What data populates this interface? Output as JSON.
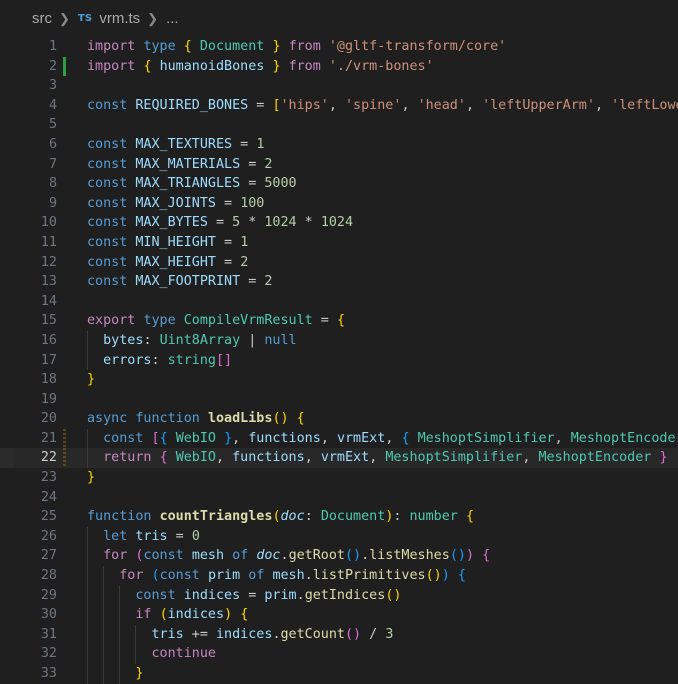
{
  "breadcrumb": {
    "folder": "src",
    "file_icon": "TS",
    "file": "vrm.ts",
    "symbol": "..."
  },
  "editor": {
    "current_line": 22,
    "lines": [
      {
        "n": "1",
        "tokens": [
          [
            "kw2",
            "import"
          ],
          [
            "c",
            " "
          ],
          [
            "kw",
            "type"
          ],
          [
            "c",
            " "
          ],
          [
            "br1",
            "{"
          ],
          [
            "c",
            " "
          ],
          [
            "ty",
            "Document"
          ],
          [
            "c",
            " "
          ],
          [
            "br1",
            "}"
          ],
          [
            "c",
            " "
          ],
          [
            "kw2",
            "from"
          ],
          [
            "c",
            " "
          ],
          [
            "str",
            "'@gltf-transform/core'"
          ]
        ]
      },
      {
        "n": "2",
        "git": "added",
        "tokens": [
          [
            "kw2",
            "import"
          ],
          [
            "c",
            " "
          ],
          [
            "br1",
            "{"
          ],
          [
            "c",
            " "
          ],
          [
            "v",
            "humanoidBones"
          ],
          [
            "c",
            " "
          ],
          [
            "br1",
            "}"
          ],
          [
            "c",
            " "
          ],
          [
            "kw2",
            "from"
          ],
          [
            "c",
            " "
          ],
          [
            "str",
            "'./vrm-bones'"
          ]
        ]
      },
      {
        "n": "3",
        "tokens": []
      },
      {
        "n": "4",
        "tokens": [
          [
            "kw",
            "const"
          ],
          [
            "c",
            " "
          ],
          [
            "v",
            "REQUIRED_BONES"
          ],
          [
            "c",
            " = "
          ],
          [
            "br1",
            "["
          ],
          [
            "str",
            "'hips'"
          ],
          [
            "c",
            ", "
          ],
          [
            "str",
            "'spine'"
          ],
          [
            "c",
            ", "
          ],
          [
            "str",
            "'head'"
          ],
          [
            "c",
            ", "
          ],
          [
            "str",
            "'leftUpperArm'"
          ],
          [
            "c",
            ", "
          ],
          [
            "str",
            "'leftLowerA"
          ]
        ]
      },
      {
        "n": "5",
        "tokens": []
      },
      {
        "n": "6",
        "tokens": [
          [
            "kw",
            "const"
          ],
          [
            "c",
            " "
          ],
          [
            "v",
            "MAX_TEXTURES"
          ],
          [
            "c",
            " = "
          ],
          [
            "num",
            "1"
          ]
        ]
      },
      {
        "n": "7",
        "tokens": [
          [
            "kw",
            "const"
          ],
          [
            "c",
            " "
          ],
          [
            "v",
            "MAX_MATERIALS"
          ],
          [
            "c",
            " = "
          ],
          [
            "num",
            "2"
          ]
        ]
      },
      {
        "n": "8",
        "tokens": [
          [
            "kw",
            "const"
          ],
          [
            "c",
            " "
          ],
          [
            "v",
            "MAX_TRIANGLES"
          ],
          [
            "c",
            " = "
          ],
          [
            "num",
            "5000"
          ]
        ]
      },
      {
        "n": "9",
        "tokens": [
          [
            "kw",
            "const"
          ],
          [
            "c",
            " "
          ],
          [
            "v",
            "MAX_JOINTS"
          ],
          [
            "c",
            " = "
          ],
          [
            "num",
            "100"
          ]
        ]
      },
      {
        "n": "10",
        "tokens": [
          [
            "kw",
            "const"
          ],
          [
            "c",
            " "
          ],
          [
            "v",
            "MAX_BYTES"
          ],
          [
            "c",
            " = "
          ],
          [
            "num",
            "5"
          ],
          [
            "c",
            " * "
          ],
          [
            "num",
            "1024"
          ],
          [
            "c",
            " * "
          ],
          [
            "num",
            "1024"
          ]
        ]
      },
      {
        "n": "11",
        "tokens": [
          [
            "kw",
            "const"
          ],
          [
            "c",
            " "
          ],
          [
            "v",
            "MIN_HEIGHT"
          ],
          [
            "c",
            " = "
          ],
          [
            "num",
            "1"
          ]
        ]
      },
      {
        "n": "12",
        "tokens": [
          [
            "kw",
            "const"
          ],
          [
            "c",
            " "
          ],
          [
            "v",
            "MAX_HEIGHT"
          ],
          [
            "c",
            " = "
          ],
          [
            "num",
            "2"
          ]
        ]
      },
      {
        "n": "13",
        "tokens": [
          [
            "kw",
            "const"
          ],
          [
            "c",
            " "
          ],
          [
            "v",
            "MAX_FOOTPRINT"
          ],
          [
            "c",
            " = "
          ],
          [
            "num",
            "2"
          ]
        ]
      },
      {
        "n": "14",
        "tokens": []
      },
      {
        "n": "15",
        "tokens": [
          [
            "kw2",
            "export"
          ],
          [
            "c",
            " "
          ],
          [
            "kw",
            "type"
          ],
          [
            "c",
            " "
          ],
          [
            "ty",
            "CompileVrmResult"
          ],
          [
            "c",
            " = "
          ],
          [
            "br1",
            "{"
          ]
        ]
      },
      {
        "n": "16",
        "indent": 1,
        "tokens": [
          [
            "c",
            "  "
          ],
          [
            "prop",
            "bytes"
          ],
          [
            "c",
            ": "
          ],
          [
            "ty",
            "Uint8Array"
          ],
          [
            "c",
            " | "
          ],
          [
            "kw",
            "null"
          ]
        ]
      },
      {
        "n": "17",
        "indent": 1,
        "tokens": [
          [
            "c",
            "  "
          ],
          [
            "prop",
            "errors"
          ],
          [
            "c",
            ": "
          ],
          [
            "ty",
            "string"
          ],
          [
            "br2",
            "[]"
          ]
        ]
      },
      {
        "n": "18",
        "tokens": [
          [
            "br1",
            "}"
          ]
        ]
      },
      {
        "n": "19",
        "tokens": []
      },
      {
        "n": "20",
        "tokens": [
          [
            "kw",
            "async"
          ],
          [
            "c",
            " "
          ],
          [
            "kw",
            "function"
          ],
          [
            "c",
            " "
          ],
          [
            "fn",
            "loadLibs"
          ],
          [
            "br1",
            "()"
          ],
          [
            "c",
            " "
          ],
          [
            "br1",
            "{"
          ]
        ]
      },
      {
        "n": "21",
        "git": "modified",
        "indent": 1,
        "tokens": [
          [
            "c",
            "  "
          ],
          [
            "kw",
            "const"
          ],
          [
            "c",
            " "
          ],
          [
            "br2",
            "["
          ],
          [
            "br3",
            "{"
          ],
          [
            "c",
            " "
          ],
          [
            "ty",
            "WebIO"
          ],
          [
            "c",
            " "
          ],
          [
            "br3",
            "}"
          ],
          [
            "c",
            ", "
          ],
          [
            "v",
            "functions"
          ],
          [
            "c",
            ", "
          ],
          [
            "v",
            "vrmExt"
          ],
          [
            "c",
            ", "
          ],
          [
            "br3",
            "{"
          ],
          [
            "c",
            " "
          ],
          [
            "ty",
            "MeshoptSimplifier"
          ],
          [
            "c",
            ", "
          ],
          [
            "ty",
            "MeshoptEncoder"
          ],
          [
            "c",
            " "
          ],
          [
            "br3",
            "}"
          ]
        ]
      },
      {
        "n": "22",
        "git": "modified",
        "indent": 1,
        "tokens": [
          [
            "c",
            "  "
          ],
          [
            "kw2",
            "return"
          ],
          [
            "c",
            " "
          ],
          [
            "br2",
            "{"
          ],
          [
            "c",
            " "
          ],
          [
            "ty",
            "WebIO"
          ],
          [
            "c",
            ", "
          ],
          [
            "v",
            "functions"
          ],
          [
            "c",
            ", "
          ],
          [
            "v",
            "vrmExt"
          ],
          [
            "c",
            ", "
          ],
          [
            "ty",
            "MeshoptSimplifier"
          ],
          [
            "c",
            ", "
          ],
          [
            "ty",
            "MeshoptEncoder"
          ],
          [
            "c",
            " "
          ],
          [
            "br2",
            "}"
          ]
        ]
      },
      {
        "n": "23",
        "tokens": [
          [
            "br1",
            "}"
          ]
        ]
      },
      {
        "n": "24",
        "tokens": []
      },
      {
        "n": "25",
        "tokens": [
          [
            "kw",
            "function"
          ],
          [
            "c",
            " "
          ],
          [
            "fn",
            "countTriangles"
          ],
          [
            "br1",
            "("
          ],
          [
            "it",
            "doc"
          ],
          [
            "c",
            ": "
          ],
          [
            "ty",
            "Document"
          ],
          [
            "br1",
            ")"
          ],
          [
            "c",
            ": "
          ],
          [
            "ty",
            "number"
          ],
          [
            "c",
            " "
          ],
          [
            "br1",
            "{"
          ]
        ]
      },
      {
        "n": "26",
        "indent": 1,
        "tokens": [
          [
            "c",
            "  "
          ],
          [
            "kw",
            "let"
          ],
          [
            "c",
            " "
          ],
          [
            "v",
            "tris"
          ],
          [
            "c",
            " = "
          ],
          [
            "num",
            "0"
          ]
        ]
      },
      {
        "n": "27",
        "indent": 1,
        "tokens": [
          [
            "c",
            "  "
          ],
          [
            "kw2",
            "for"
          ],
          [
            "c",
            " "
          ],
          [
            "br2",
            "("
          ],
          [
            "kw",
            "const"
          ],
          [
            "c",
            " "
          ],
          [
            "v",
            "mesh"
          ],
          [
            "c",
            " "
          ],
          [
            "kw",
            "of"
          ],
          [
            "c",
            " "
          ],
          [
            "it",
            "doc"
          ],
          [
            "c",
            "."
          ],
          [
            "mt",
            "getRoot"
          ],
          [
            "br3",
            "()"
          ],
          [
            "c",
            "."
          ],
          [
            "mt",
            "listMeshes"
          ],
          [
            "br3",
            "()"
          ],
          [
            "br2",
            ")"
          ],
          [
            "c",
            " "
          ],
          [
            "br2",
            "{"
          ]
        ]
      },
      {
        "n": "28",
        "indent": 2,
        "tokens": [
          [
            "c",
            "    "
          ],
          [
            "kw2",
            "for"
          ],
          [
            "c",
            " "
          ],
          [
            "br3",
            "("
          ],
          [
            "kw",
            "const"
          ],
          [
            "c",
            " "
          ],
          [
            "v",
            "prim"
          ],
          [
            "c",
            " "
          ],
          [
            "kw",
            "of"
          ],
          [
            "c",
            " "
          ],
          [
            "v",
            "mesh"
          ],
          [
            "c",
            "."
          ],
          [
            "mt",
            "listPrimitives"
          ],
          [
            "br1",
            "()"
          ],
          [
            "br3",
            ")"
          ],
          [
            "c",
            " "
          ],
          [
            "br3",
            "{"
          ]
        ]
      },
      {
        "n": "29",
        "indent": 3,
        "tokens": [
          [
            "c",
            "      "
          ],
          [
            "kw",
            "const"
          ],
          [
            "c",
            " "
          ],
          [
            "v",
            "indices"
          ],
          [
            "c",
            " = "
          ],
          [
            "v",
            "prim"
          ],
          [
            "c",
            "."
          ],
          [
            "mt",
            "getIndices"
          ],
          [
            "br1",
            "()"
          ]
        ]
      },
      {
        "n": "30",
        "indent": 3,
        "tokens": [
          [
            "c",
            "      "
          ],
          [
            "kw2",
            "if"
          ],
          [
            "c",
            " "
          ],
          [
            "br1",
            "("
          ],
          [
            "v",
            "indices"
          ],
          [
            "br1",
            ")"
          ],
          [
            "c",
            " "
          ],
          [
            "br1",
            "{"
          ]
        ]
      },
      {
        "n": "31",
        "indent": 4,
        "tokens": [
          [
            "c",
            "        "
          ],
          [
            "v",
            "tris"
          ],
          [
            "c",
            " += "
          ],
          [
            "v",
            "indices"
          ],
          [
            "c",
            "."
          ],
          [
            "mt",
            "getCount"
          ],
          [
            "br2",
            "()"
          ],
          [
            "c",
            " / "
          ],
          [
            "num",
            "3"
          ]
        ]
      },
      {
        "n": "32",
        "indent": 4,
        "tokens": [
          [
            "c",
            "        "
          ],
          [
            "kw2",
            "continue"
          ]
        ]
      },
      {
        "n": "33",
        "indent": 3,
        "tokens": [
          [
            "c",
            "      "
          ],
          [
            "br1",
            "}"
          ]
        ]
      }
    ]
  }
}
